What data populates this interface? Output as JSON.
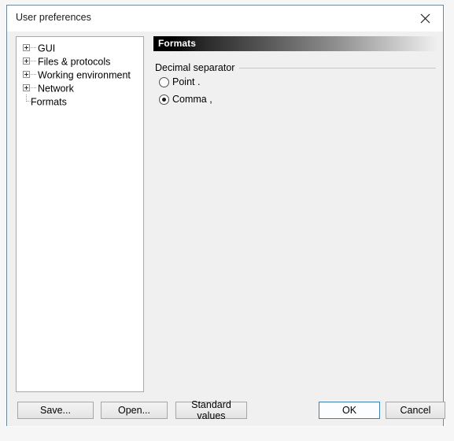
{
  "window": {
    "title": "User preferences",
    "close_icon": "close-icon"
  },
  "tree": {
    "items": [
      {
        "label": "GUI",
        "type": "branch",
        "expanded": false
      },
      {
        "label": "Files & protocols",
        "type": "branch",
        "expanded": false
      },
      {
        "label": "Working environment",
        "type": "branch",
        "expanded": false
      },
      {
        "label": "Network",
        "type": "branch",
        "expanded": false
      },
      {
        "label": "Formats",
        "type": "leaf",
        "selected": false
      }
    ]
  },
  "content": {
    "header": "Formats",
    "group": {
      "title": "Decimal separator",
      "options": [
        {
          "label": "Point .",
          "checked": false
        },
        {
          "label": "Comma ,",
          "checked": true
        }
      ]
    }
  },
  "footer": {
    "save": "Save...",
    "open": "Open...",
    "standard_values": "Standard values",
    "ok": "OK",
    "cancel": "Cancel"
  },
  "colors": {
    "window_border": "#6b8699",
    "dialog_background": "#f0f0f0",
    "titlebar_background": "#ffffff",
    "header_gradient_start": "#000000",
    "header_gradient_end": "#efefef",
    "primary_button_border": "#3c7fb1"
  }
}
